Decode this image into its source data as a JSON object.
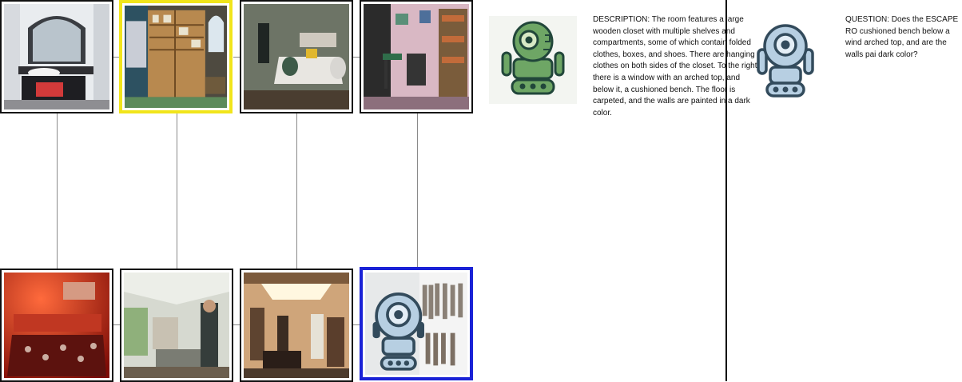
{
  "images": [
    {
      "label": "bathroom-image"
    },
    {
      "label": "closet-image"
    },
    {
      "label": "bedroom-image"
    },
    {
      "label": "study-room-image"
    },
    {
      "label": "red-bedroom-image"
    },
    {
      "label": "living-room-image"
    },
    {
      "label": "hallway-image"
    },
    {
      "label": "walk-in-closet-image"
    }
  ],
  "colors": {
    "selected_primary": "#f1e51b",
    "selected_secondary": "#1a22d6",
    "robot_green": "#6ea665",
    "robot_blue": "#b7cfe2"
  },
  "panels": {
    "description": "DESCRIPTION: The room features a large wooden closet with multiple shelves and compartments, some of which contain folded clothes, boxes, and shoes. There are hanging clothes on both sides of the closet. To the right, there is a window with an arched top, and below it, a cushioned bench. The floor is carpeted, and the walls are painted in a dark color.",
    "question": "QUESTION: Does the ESCAPE RO cushioned bench below a wind arched top, and are the walls pai dark color?"
  }
}
